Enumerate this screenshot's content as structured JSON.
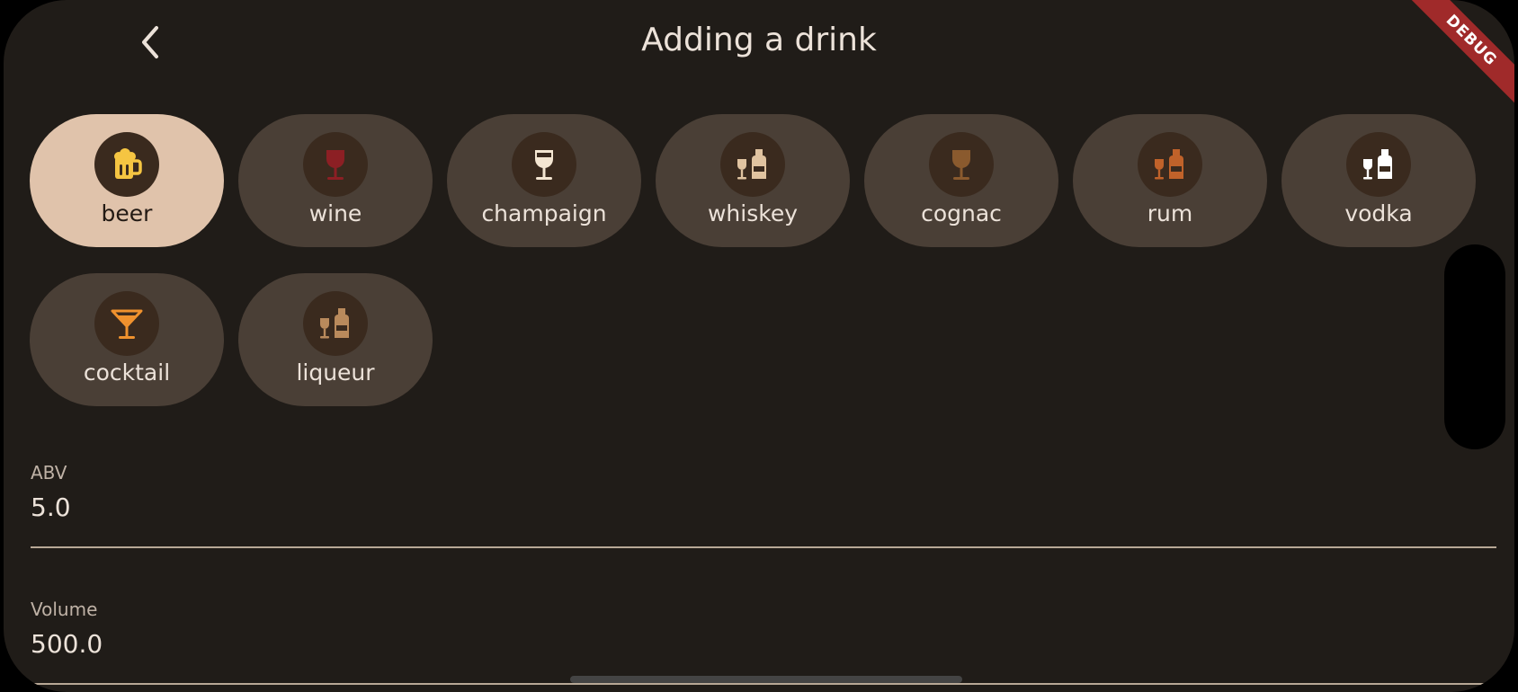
{
  "header": {
    "title": "Adding a drink",
    "back_icon": "chevron-left-icon",
    "debug_banner": "DEBUG"
  },
  "drink_types": {
    "selected": "beer",
    "items": [
      {
        "id": "beer",
        "label": "beer",
        "icon": "beer-mug-icon",
        "color": "#f5c542"
      },
      {
        "id": "wine",
        "label": "wine",
        "icon": "wine-glass-icon",
        "color": "#8c1f24"
      },
      {
        "id": "champaign",
        "label": "champaign",
        "icon": "wine-glass-icon",
        "color": "#f4e6d2"
      },
      {
        "id": "whiskey",
        "label": "whiskey",
        "icon": "bottle-and-glass-icon",
        "color": "#e0c3a0"
      },
      {
        "id": "cognac",
        "label": "cognac",
        "icon": "wine-glass-icon",
        "color": "#8a5a2e"
      },
      {
        "id": "rum",
        "label": "rum",
        "icon": "bottle-and-glass-icon",
        "color": "#c0622a"
      },
      {
        "id": "vodka",
        "label": "vodka",
        "icon": "bottle-and-glass-icon",
        "color": "#ffffff"
      },
      {
        "id": "cocktail",
        "label": "cocktail",
        "icon": "cocktail-glass-icon",
        "color": "#f0922e"
      },
      {
        "id": "liqueur",
        "label": "liqueur",
        "icon": "bottle-and-glass-icon",
        "color": "#b98a5c"
      }
    ]
  },
  "form": {
    "abv": {
      "label": "ABV",
      "value": "5.0"
    },
    "volume": {
      "label": "Volume",
      "value": "500.0"
    }
  },
  "colors": {
    "background": "#201c18",
    "chip": "#4a3f36",
    "chip_selected": "#e0c3ab",
    "icon_circle": "#3a2a1e",
    "accent_line": "#b8a896"
  }
}
